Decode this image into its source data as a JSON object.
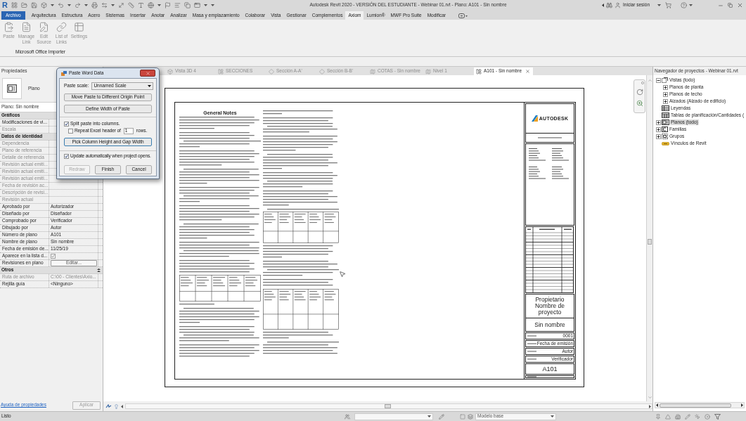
{
  "window": {
    "logo": "R",
    "title": "Autodesk Revit 2020 - VERSIÓN DEL ESTUDIANTE - Webinar 01.rvt - Plano: A101 - Sin nombre",
    "account": "Iniciar sesión"
  },
  "ribbon": {
    "tabs": [
      {
        "label": "Archivo",
        "kind": "file",
        "selected": false
      },
      {
        "label": "Arquitectura",
        "kind": "tab",
        "selected": false
      },
      {
        "label": "Estructura",
        "kind": "tab",
        "selected": false
      },
      {
        "label": "Acero",
        "kind": "tab",
        "selected": false
      },
      {
        "label": "Sistemas",
        "kind": "tab",
        "selected": false
      },
      {
        "label": "Insertar",
        "kind": "tab",
        "selected": false
      },
      {
        "label": "Anotar",
        "kind": "tab",
        "selected": false
      },
      {
        "label": "Analizar",
        "kind": "tab",
        "selected": false
      },
      {
        "label": "Masa y emplazamiento",
        "kind": "tab",
        "selected": false
      },
      {
        "label": "Colaborar",
        "kind": "tab",
        "selected": false
      },
      {
        "label": "Vista",
        "kind": "tab",
        "selected": false
      },
      {
        "label": "Gestionar",
        "kind": "tab",
        "selected": false
      },
      {
        "label": "Complementos",
        "kind": "tab",
        "selected": false
      },
      {
        "label": "Axiom",
        "kind": "tab",
        "selected": true
      },
      {
        "label": "Lumion®",
        "kind": "tab",
        "selected": false
      },
      {
        "label": "MWF Pro Suite",
        "kind": "tab",
        "selected": false
      },
      {
        "label": "Modificar",
        "kind": "tab",
        "selected": false
      }
    ],
    "tools": [
      {
        "label": "Paste",
        "disabled": true
      },
      {
        "label": "Manage Link",
        "disabled": true
      },
      {
        "label": "Edit Source",
        "disabled": true
      },
      {
        "label": "List of Links",
        "disabled": true
      },
      {
        "label": "Settings",
        "disabled": true
      }
    ],
    "panel_title": "Microsoft Office Importer"
  },
  "properties": {
    "title": "Propiedades",
    "type_name": "Plano",
    "instance": "Plano: Sin nombre",
    "rows": [
      {
        "kind": "group",
        "label": "Gráficos"
      },
      {
        "kind": "text",
        "label": "Modificaciones de vi...",
        "disabled": false
      },
      {
        "kind": "text",
        "label": "Escala",
        "disabled": true
      },
      {
        "kind": "group",
        "label": "Datos de identidad"
      },
      {
        "kind": "text",
        "label": "Dependencia",
        "disabled": true
      },
      {
        "kind": "text",
        "label": "Plano de referencia",
        "disabled": true
      },
      {
        "kind": "text",
        "label": "Detalle de referencia",
        "disabled": true
      },
      {
        "kind": "text",
        "label": "Revisión actual emiti...",
        "disabled": true
      },
      {
        "kind": "text",
        "label": "Revisión actual emiti...",
        "disabled": true
      },
      {
        "kind": "text",
        "label": "Revisión actual emiti...",
        "disabled": true
      },
      {
        "kind": "text",
        "label": "Fecha de revisión ac...",
        "disabled": true
      },
      {
        "kind": "text",
        "label": "Descripción de revisi...",
        "disabled": true
      },
      {
        "kind": "text",
        "label": "Revisión actual",
        "disabled": true
      },
      {
        "kind": "text",
        "label": "Aprobado por",
        "value": "Autorizador",
        "disabled": false
      },
      {
        "kind": "text",
        "label": "Diseñado por",
        "value": "Diseñador",
        "disabled": false
      },
      {
        "kind": "text",
        "label": "Comprobado por",
        "value": "Verificador",
        "disabled": false
      },
      {
        "kind": "text",
        "label": "Dibujado por",
        "value": "Autor",
        "disabled": false
      },
      {
        "kind": "text",
        "label": "Número de plano",
        "value": "A101",
        "disabled": false
      },
      {
        "kind": "text",
        "label": "Nombre de plano",
        "value": "Sin nombre",
        "disabled": false
      },
      {
        "kind": "text",
        "label": "Fecha de emisión de...",
        "value": "11/25/19",
        "disabled": false
      },
      {
        "kind": "checkbox",
        "label": "Aparece en la lista d...",
        "checked": true,
        "disabled": false
      },
      {
        "kind": "button",
        "label": "Revisiones en plano",
        "value": "Editar...",
        "disabled": false
      },
      {
        "kind": "group",
        "label": "Otros",
        "toggle": true
      },
      {
        "kind": "text",
        "label": "Ruta de archivo",
        "value": "C:\\00 - Clientes\\Axio...",
        "disabled": true
      },
      {
        "kind": "text",
        "label": "Rejilla guía",
        "value": "<Ninguno>",
        "disabled": false
      }
    ],
    "help_link": "Ayuda de propiedades",
    "apply": {
      "label": "Aplicar",
      "disabled": true
    }
  },
  "view_tabs": [
    {
      "label": "Vista 3D 4",
      "kind": "model",
      "selected": false
    },
    {
      "label": "SECCIONES",
      "kind": "sheet",
      "selected": false
    },
    {
      "label": "Sección A-A'",
      "kind": "section",
      "selected": false
    },
    {
      "label": "Sección B-B'",
      "kind": "section",
      "selected": false
    },
    {
      "label": "COTAS - Sin nombre",
      "kind": "plan",
      "selected": false
    },
    {
      "label": "Nivel 1",
      "kind": "plan",
      "selected": false
    },
    {
      "label": "A101 - Sin nombre",
      "kind": "sheet",
      "selected": true
    }
  ],
  "sheet": {
    "heading": "General Notes",
    "brand": "AUTODESK",
    "owner": "Propietario",
    "project": "Nombre de proyecto",
    "project_value": "Sin nombre",
    "fields": [
      {
        "value": "0001"
      },
      {
        "value": "Fecha de emisión"
      },
      {
        "value": "Autor"
      },
      {
        "value": "Verificador"
      }
    ],
    "sheet_number": "A101"
  },
  "dialog": {
    "title": "Paste Word Data",
    "scale_label": "Paste scale:",
    "scale_value": "Unnamed Scale",
    "buttons": [
      "Move Paste to Different Origin Point",
      "Define Width of Paste"
    ],
    "split": {
      "label": "Split paste into columns.",
      "checked": true
    },
    "repeat": {
      "label": "Repeat Excel header of",
      "value": "1",
      "suffix": "rows.",
      "checked": false
    },
    "pick": {
      "label": "Pick Column Height and Gap Width",
      "focused": true
    },
    "update": {
      "label": "Update automatically when project opens.",
      "checked": true
    },
    "actions": [
      {
        "label": "Redraw",
        "disabled": true
      },
      {
        "label": "Finish",
        "disabled": false
      },
      {
        "label": "Cancel",
        "disabled": false
      }
    ]
  },
  "project_browser": {
    "title": "Navegador de proyectos - Webinar 01.rvt",
    "items": [
      {
        "label": "Vistas (todo)",
        "kind": "views",
        "expanded": true,
        "selected": false,
        "children": [
          {
            "label": "Planos de planta",
            "expanded": false,
            "selected": false
          },
          {
            "label": "Planos de techo",
            "expanded": false,
            "selected": false
          },
          {
            "label": "Alzados (Alzado de edificio)",
            "expanded": false,
            "selected": false
          }
        ]
      },
      {
        "label": "Leyendas",
        "kind": "legends",
        "selected": false
      },
      {
        "label": "Tablas de planificación/Cantidades (",
        "kind": "schedules",
        "selected": false
      },
      {
        "label": "Planos (todo)",
        "kind": "sheets",
        "expanded": false,
        "selected": true
      },
      {
        "label": "Familias",
        "kind": "families",
        "expanded": false,
        "selected": false
      },
      {
        "label": "Grupos",
        "kind": "groups",
        "expanded": false,
        "selected": false
      },
      {
        "label": "Vínculos de Revit",
        "kind": "links",
        "selected": false
      }
    ]
  },
  "status_bar": {
    "text": "Listo",
    "model": "Modelo base"
  }
}
